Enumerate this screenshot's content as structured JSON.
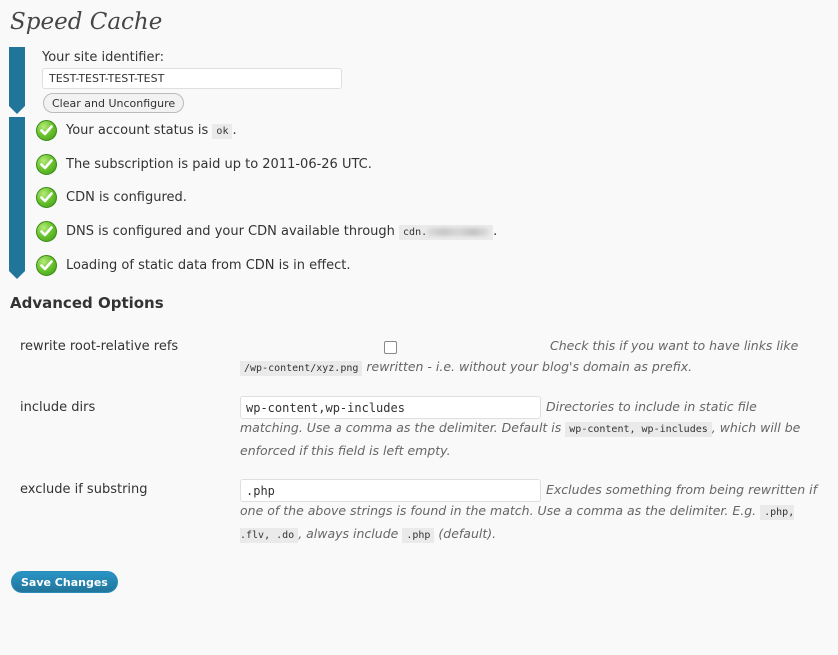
{
  "page": {
    "title": "Speed Cache"
  },
  "site": {
    "label": "Your site identifier:",
    "identifier": "TEST-TEST-TEST-TEST",
    "clear_button": "Clear and Unconfigure"
  },
  "status": {
    "account_prefix": "Your account status is",
    "account_value": "ok",
    "account_suffix": ".",
    "subscription": "The subscription is paid up to 2011-06-26 UTC.",
    "cdn": "CDN is configured.",
    "dns_prefix": "DNS is configured and your CDN available through",
    "dns_host": "cdn.",
    "dns_suffix": ".",
    "static": "Loading of static data from CDN is in effect.",
    "icon": "check-icon",
    "icon_color": "#5cb82a"
  },
  "advanced": {
    "heading": "Advanced Options",
    "rewrite": {
      "label": "rewrite root-relative refs",
      "checked": false,
      "desc_1": "Check this if you want to have links like",
      "code": "/wp-content/xyz.png",
      "desc_2": "rewritten - i.e. without your blog's domain as prefix."
    },
    "include": {
      "label": "include dirs",
      "value": "wp-content,wp-includes",
      "desc_1": "Directories to include in static file matching. Use a comma as the delimiter. Default is",
      "code": "wp-content, wp-includes",
      "desc_2": ", which will be enforced if this field is left empty."
    },
    "exclude": {
      "label": "exclude if substring",
      "value": ".php",
      "desc_1": "Excludes something from being rewritten if one of the above strings is found in the match. Use a comma as the delimiter. E.g.",
      "code_1": ".php, .flv, .do",
      "desc_2": ", always include",
      "code_2": ".php",
      "desc_3": "(default)."
    }
  },
  "save_button": "Save Changes",
  "colors": {
    "accent": "#21759b",
    "background": "#f9f9f9"
  }
}
